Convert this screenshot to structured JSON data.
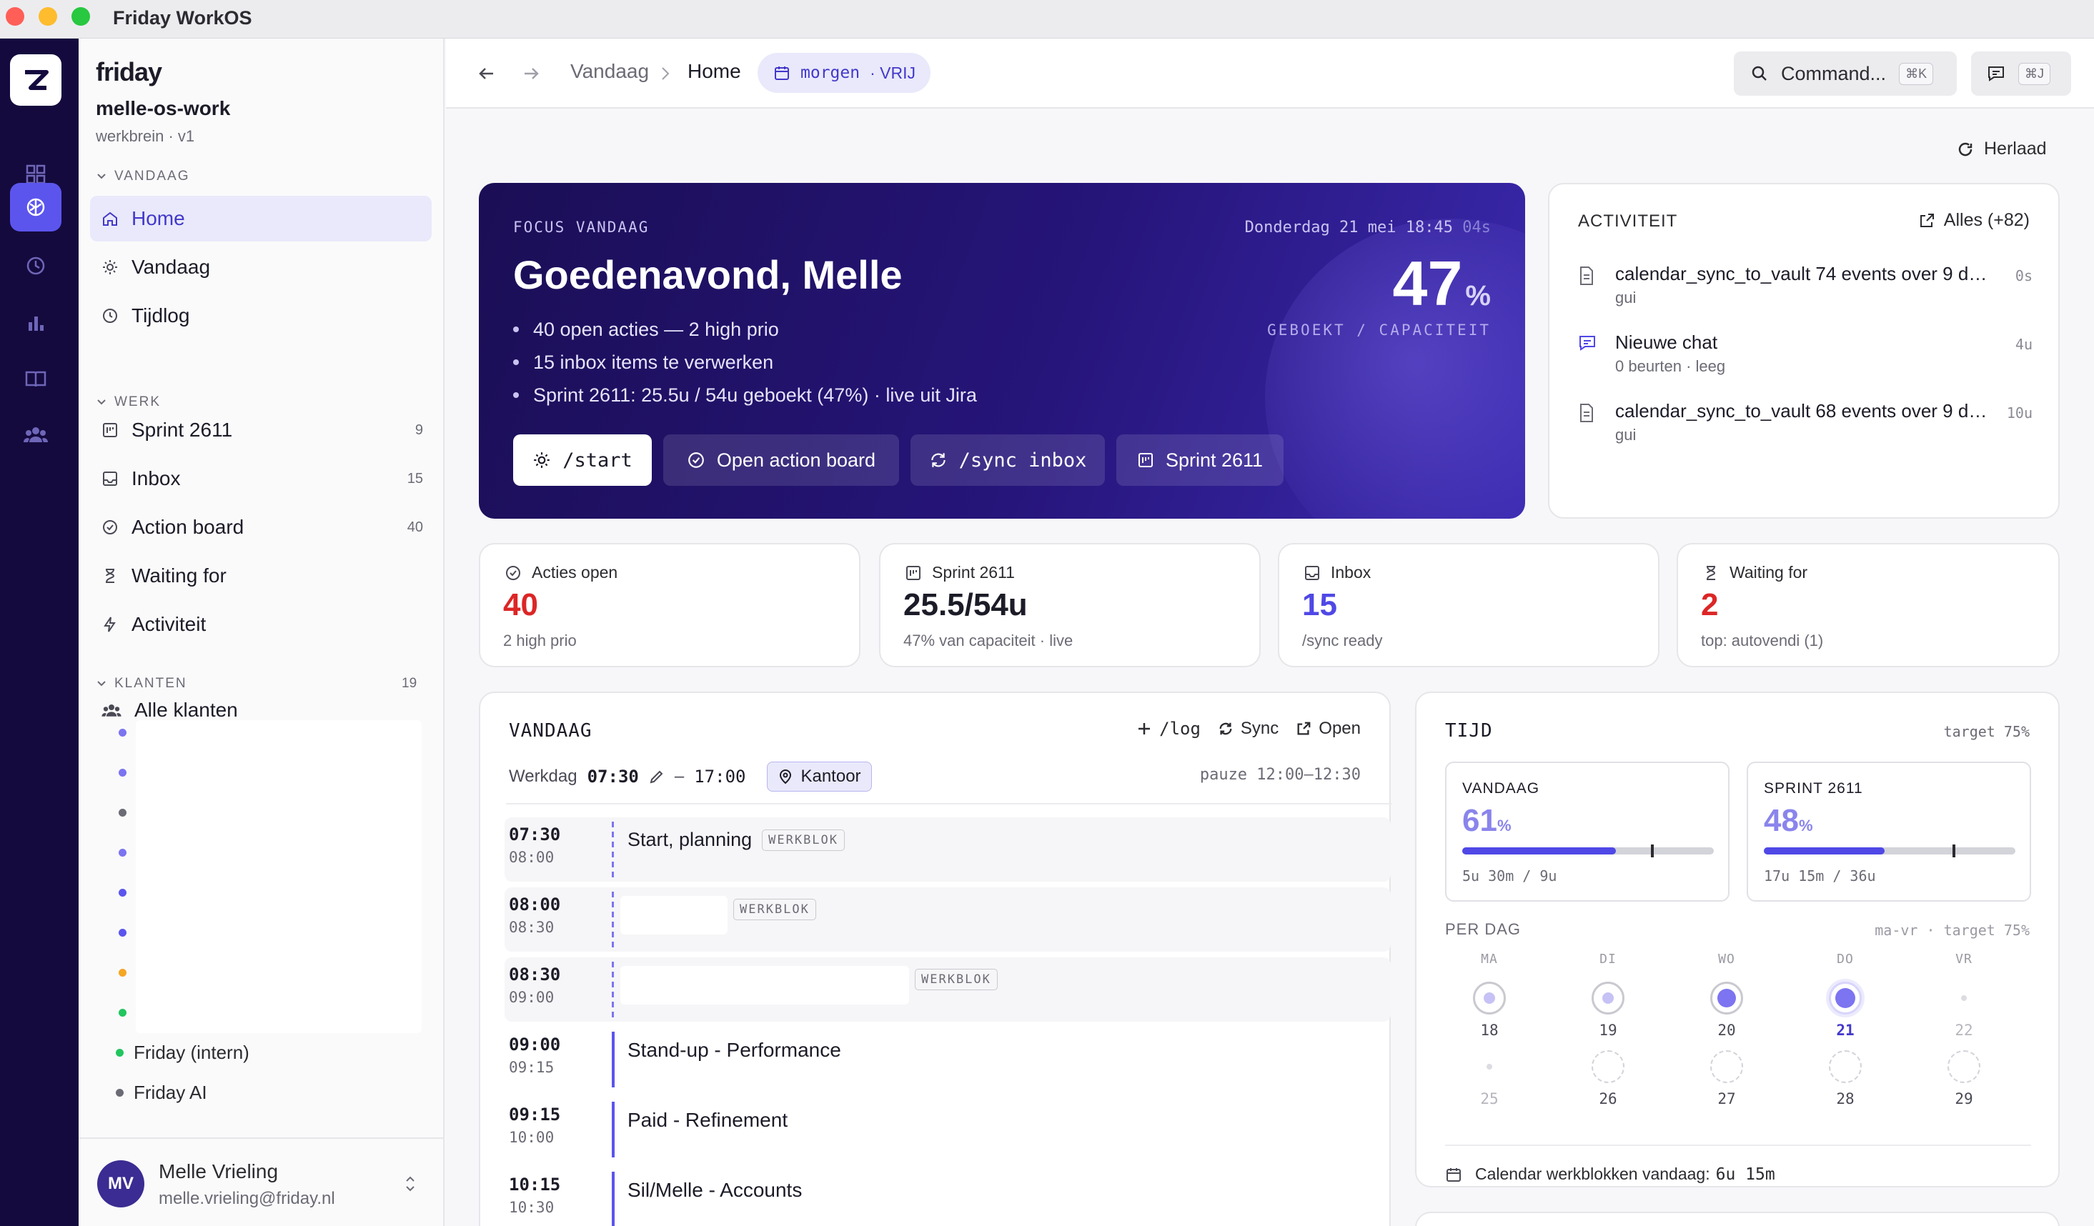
{
  "window": {
    "title": "Friday WorkOS"
  },
  "sidebar": {
    "brand": "friday",
    "workspace_name": "melle-os-work",
    "workspace_sub": "werkbrein · v1",
    "section_today": "VANDAAG",
    "section_work": "WERK",
    "section_clients": "KLANTEN",
    "clients_count": "19",
    "nav_today": [
      {
        "label": "Home",
        "icon": "home-icon"
      },
      {
        "label": "Vandaag",
        "icon": "sun-icon"
      },
      {
        "label": "Tijdlog",
        "icon": "clock-icon"
      }
    ],
    "nav_work": [
      {
        "label": "Sprint 2611",
        "count": "9",
        "icon": "sprint-icon"
      },
      {
        "label": "Inbox",
        "count": "15",
        "icon": "inbox-icon"
      },
      {
        "label": "Action board",
        "count": "40",
        "icon": "check-circle-icon"
      },
      {
        "label": "Waiting for",
        "count": "",
        "icon": "hourglass-icon"
      },
      {
        "label": "Activiteit",
        "count": "",
        "icon": "bolt-icon"
      }
    ],
    "all_clients": "Alle klanten",
    "client_dot_colors": [
      "#7c74f0",
      "#7c74f0",
      "#6b6b75",
      "#7c74f0",
      "#5b55ee",
      "#5b55ee",
      "#f5a623",
      "#22c55e"
    ],
    "clients": [
      {
        "name": "Friday (intern)",
        "color": "#22c55e"
      },
      {
        "name": "Friday AI",
        "color": "#6b6b75"
      }
    ],
    "user": {
      "initials": "MV",
      "name": "Melle Vrieling",
      "email": "melle.vrieling@friday.nl"
    }
  },
  "topbar": {
    "crumb_1": "Vandaag",
    "crumb_2": "Home",
    "date_pill_day": "morgen",
    "date_pill_status": "· VRIJ",
    "command_label": "Command...",
    "command_kbd": "⌘K",
    "chat_kbd": "⌘J",
    "reload_label": "Herlaad"
  },
  "hero": {
    "eyebrow": "FOCUS VANDAAG",
    "datetime": "Donderdag 21 mei 18:45",
    "seconds": "04s",
    "greeting": "Goedenavond, Melle",
    "bullets": [
      "40 open acties — 2 high prio",
      "15 inbox items te verwerken",
      "Sprint 2611: 25.5u / 54u geboekt (47%) · live uit Jira"
    ],
    "percent": "47",
    "percent_sign": "%",
    "percent_label": "GEBOEKT / CAPACITEIT",
    "buttons": [
      "/start",
      "Open action board",
      "/sync inbox",
      "Sprint 2611"
    ]
  },
  "activity": {
    "title": "ACTIVITEIT",
    "all_label": "Alles (+82)",
    "items": [
      {
        "title": "calendar_sync_to_vault 74 events over 9 days",
        "sub": "gui",
        "age": "0s",
        "icon": "document-icon"
      },
      {
        "title": "Nieuwe chat",
        "sub": "0 beurten · leeg",
        "age": "4u",
        "icon": "chat-icon"
      },
      {
        "title": "calendar_sync_to_vault 68 events over 9 days",
        "sub": "gui",
        "age": "10u",
        "icon": "document-icon"
      }
    ]
  },
  "stats": [
    {
      "label": "Acties open",
      "value": "40",
      "sub": "2 high prio",
      "color": "#dc2626",
      "icon": "check-circle-icon"
    },
    {
      "label": "Sprint 2611",
      "value": "25.5/54u",
      "sub": "47% van capaciteit · live",
      "color": "#1c1c28",
      "icon": "sprint-icon"
    },
    {
      "label": "Inbox",
      "value": "15",
      "sub": "/sync ready",
      "color": "#4f48e6",
      "icon": "inbox-icon"
    },
    {
      "label": "Waiting for",
      "value": "2",
      "sub": "top: autovendi (1)",
      "color": "#dc2626",
      "icon": "hourglass-icon"
    }
  ],
  "today": {
    "title": "VANDAAG",
    "action_log": "/log",
    "action_sync": "Sync",
    "action_open": "Open",
    "workday_label": "Werkdag",
    "start": "07:30",
    "dash": "–",
    "end": "17:00",
    "location": "Kantoor",
    "pause": "pauze 12:00–12:30",
    "slots": [
      {
        "start": "07:30",
        "end": "08:00",
        "title": "Start, planning",
        "tag": "WERKBLOK"
      },
      {
        "start": "08:00",
        "end": "08:30",
        "title": "",
        "tag": "WERKBLOK"
      },
      {
        "start": "08:30",
        "end": "09:00",
        "title": "",
        "tag": "WERKBLOK"
      },
      {
        "start": "09:00",
        "end": "09:15",
        "title": "Stand-up - Performance",
        "tag": ""
      },
      {
        "start": "09:15",
        "end": "10:00",
        "title": "Paid - Refinement",
        "tag": ""
      },
      {
        "start": "10:15",
        "end": "10:30",
        "title": "Sil/Melle - Accounts",
        "tag": ""
      }
    ]
  },
  "time": {
    "title": "TIJD",
    "target": "target 75%",
    "gauges": [
      {
        "label": "VANDAAG",
        "value": "61",
        "unit": "%",
        "fill": 0.61,
        "target": 0.75,
        "sub": "5u 30m / 9u"
      },
      {
        "label": "SPRINT 2611",
        "value": "48",
        "unit": "%",
        "fill": 0.48,
        "target": 0.75,
        "sub": "17u 15m / 36u"
      }
    ],
    "per_day_label": "PER DAG",
    "per_day_target": "ma-vr · target 75%",
    "weekdays": [
      "MA",
      "DI",
      "WO",
      "DO",
      "VR"
    ],
    "week1": [
      "18",
      "19",
      "20",
      "21",
      "22"
    ],
    "week2": [
      "25",
      "26",
      "27",
      "28",
      "29"
    ],
    "footer_label": "Calendar werkblokken vandaag:",
    "footer_value": "6u 15m"
  }
}
